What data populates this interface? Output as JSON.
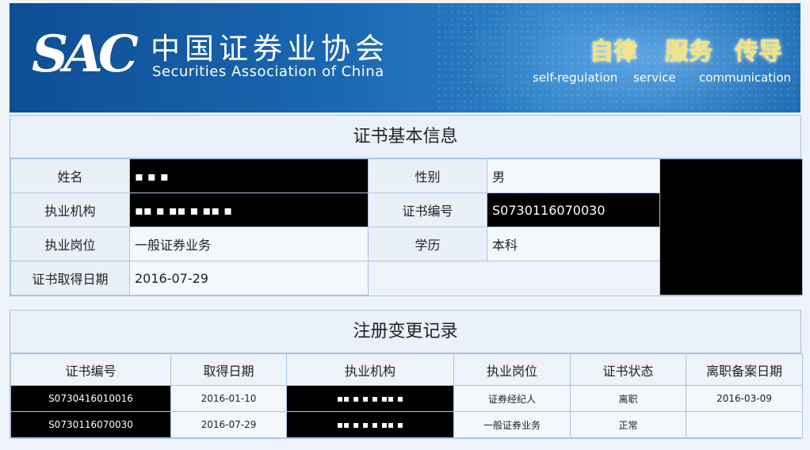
{
  "header": {
    "logo_mark": "SAC",
    "org_name_cn": "中国证券业协会",
    "org_name_en": "Securities Association of China",
    "slogans": [
      {
        "cn": "自律",
        "en": "self-regulation"
      },
      {
        "cn": "服务",
        "en": "service"
      },
      {
        "cn": "传导",
        "en": "communication"
      }
    ]
  },
  "basic_info": {
    "title": "证书基本信息",
    "name_label": "姓名",
    "name_value": "▪ ▪ ▪",
    "gender_label": "性别",
    "gender_value": "男",
    "org_label": "执业机构",
    "org_value": "▪▪  ▪ ▪▪  ▪ ▪▪  ▪",
    "cert_no_label": "证书编号",
    "cert_no_value": "S0730116070030",
    "position_label": "执业岗位",
    "position_value": "一般证券业务",
    "edu_label": "学历",
    "edu_value": "本科",
    "date_label": "证书取得日期",
    "date_value": "2016-07-29"
  },
  "records": {
    "title": "注册变更记录",
    "columns": [
      "证书编号",
      "取得日期",
      "执业机构",
      "执业岗位",
      "证书状态",
      "离职备案日期"
    ],
    "rows": [
      {
        "cert_no": "S0730416010016",
        "date": "2016-01-10",
        "org": "▪▪  ▪ ▪  ▪ ▪▪  ▪",
        "position": "证券经纪人",
        "status": "离职",
        "leave_date": "2016-03-09"
      },
      {
        "cert_no": "S0730116070030",
        "date": "2016-07-29",
        "org": "▪▪  ▪ ▪  ▪ ▪▪  ▪",
        "position": "一般证券业务",
        "status": "正常",
        "leave_date": ""
      }
    ]
  }
}
